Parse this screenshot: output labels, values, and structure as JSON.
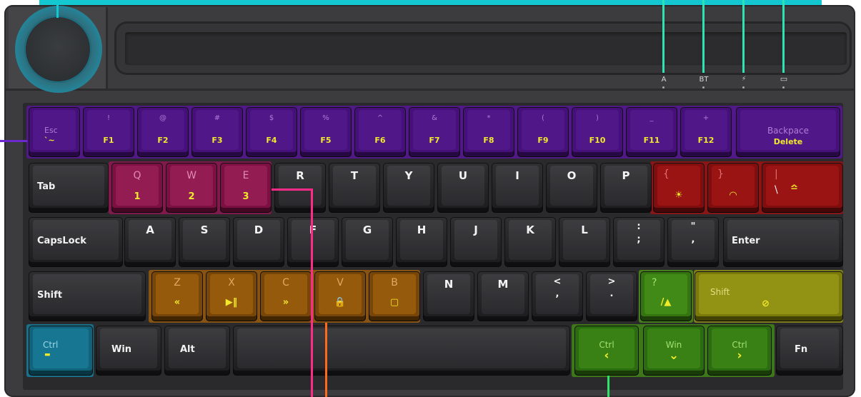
{
  "colors": {
    "accent_cyan": "#14c8d2",
    "indicator_line": "#2ee3b3",
    "layer_purple": "#5a1a9a",
    "layer_magenta": "#9a1a5a",
    "layer_red": "#a01010",
    "layer_orange": "#9a5a08",
    "layer_olive": "#8a8a10",
    "layer_green": "#3c8a10",
    "layer_blue": "#0e6e86",
    "secondary_legend": "#f0ea2a",
    "callout_pink": "#ff2b88",
    "callout_orange": "#ff6a1a",
    "callout_purple": "#6a2ad0"
  },
  "indicators": [
    {
      "label": "A",
      "icon": null
    },
    {
      "label": "BT",
      "icon": null
    },
    {
      "label": "",
      "icon": "bolt-icon",
      "glyph": "⚡"
    },
    {
      "label": "",
      "icon": "battery-icon",
      "glyph": "▭"
    }
  ],
  "rows": {
    "fn_row": [
      {
        "top": "Esc",
        "bottom": "`~",
        "name": "esc"
      },
      {
        "top": "!",
        "bottom": "F1",
        "name": "f1"
      },
      {
        "top": "@",
        "bottom": "F2",
        "name": "f2"
      },
      {
        "top": "#",
        "bottom": "F3",
        "name": "f3"
      },
      {
        "top": "$",
        "bottom": "F4",
        "name": "f4"
      },
      {
        "top": "%",
        "bottom": "F5",
        "name": "f5"
      },
      {
        "top": "^",
        "bottom": "F6",
        "name": "f6"
      },
      {
        "top": "&",
        "bottom": "F7",
        "name": "f7"
      },
      {
        "top": "*",
        "bottom": "F8",
        "name": "f8"
      },
      {
        "top": "(",
        "bottom": "F9",
        "name": "f9"
      },
      {
        "top": ")",
        "bottom": "F10",
        "name": "f10"
      },
      {
        "top": "_",
        "bottom": "F11",
        "name": "f11"
      },
      {
        "top": "+",
        "bottom": "F12",
        "name": "f12"
      },
      {
        "top": "Backpace",
        "bottom": "Delete",
        "name": "backspace"
      }
    ],
    "row2": {
      "tab": "Tab",
      "q": {
        "top": "Q",
        "bottom": "1"
      },
      "w": {
        "top": "W",
        "bottom": "2"
      },
      "e": {
        "top": "E",
        "bottom": "3"
      },
      "letters": [
        "R",
        "T",
        "Y",
        "U",
        "I",
        "O",
        "P"
      ],
      "lbracket": {
        "top": "{",
        "icon": "brightness-up-icon",
        "glyph": "☀"
      },
      "rbracket": {
        "top": "}",
        "icon": "gauge-icon",
        "glyph": "◠"
      },
      "backslash": {
        "top": "|",
        "mid": "\\",
        "icon": "wave-icon",
        "glyph": "≏"
      }
    },
    "row3": {
      "caps": "CapsLock",
      "letters": [
        "A",
        "S",
        "D",
        "F",
        "G",
        "H",
        "J",
        "K",
        "L"
      ],
      "semicolon": {
        "top": ":",
        "bottom": ";"
      },
      "quote": {
        "top": "\"",
        "bottom": ","
      },
      "enter": "Enter"
    },
    "row4": {
      "shift_left": "Shift",
      "z": {
        "top": "Z",
        "bottom": "«"
      },
      "x": {
        "top": "X",
        "bottom": "▶‖"
      },
      "c": {
        "top": "C",
        "bottom": "»"
      },
      "v": {
        "top": "V",
        "bottom": "🔒"
      },
      "b": {
        "top": "B",
        "bottom": "▢"
      },
      "letters": [
        "N",
        "M"
      ],
      "comma": {
        "top": "<",
        "bottom": ","
      },
      "period": {
        "top": ">",
        "bottom": "."
      },
      "slash": {
        "top": "?",
        "bottom": "/▲"
      },
      "shift_right": {
        "top": "Shift",
        "bottom": "⊘"
      }
    },
    "row5": {
      "ctrl_left": {
        "top": "Ctrl",
        "bottom": "▬"
      },
      "win": "Win",
      "alt": "Alt",
      "ctrl_right": {
        "top": "Ctrl",
        "bottom": "‹"
      },
      "win_right": {
        "top": "Win",
        "bottom": "⌄"
      },
      "ctrl_far": {
        "top": "Ctrl",
        "bottom": "›"
      },
      "fn": "Fn"
    }
  }
}
